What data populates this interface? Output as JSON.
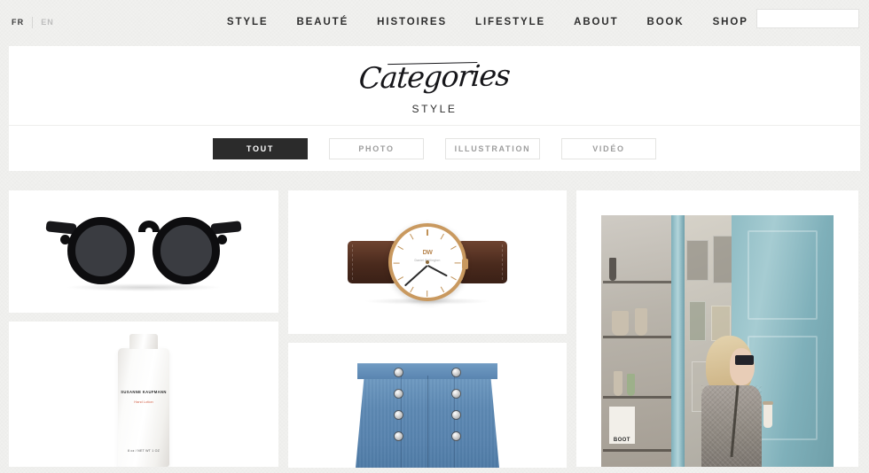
{
  "nav": {
    "languages": [
      {
        "label": "FR",
        "active": true
      },
      {
        "label": "EN",
        "active": false
      }
    ],
    "menu": [
      {
        "label": "STYLE"
      },
      {
        "label": "BEAUTÉ"
      },
      {
        "label": "HISTOIRES"
      },
      {
        "label": "LIFESTYLE"
      },
      {
        "label": "ABOUT"
      },
      {
        "label": "BOOK"
      },
      {
        "label": "SHOP"
      }
    ],
    "search": {
      "value": "",
      "placeholder": "",
      "icon": "search-icon"
    }
  },
  "header": {
    "script_title": "Categories",
    "subtitle": "STYLE"
  },
  "filters": [
    {
      "label": "TOUT",
      "active": true
    },
    {
      "label": "PHOTO",
      "active": false
    },
    {
      "label": "ILLUSTRATION",
      "active": false
    },
    {
      "label": "VIDÉO",
      "active": false
    }
  ],
  "grid": {
    "items": [
      {
        "name": "sunglasses",
        "description": "Black round frame sunglasses"
      },
      {
        "name": "hand-lotion",
        "description": "White cosmetic bottle"
      },
      {
        "name": "watch",
        "description": "Rose gold watch with brown leather strap"
      },
      {
        "name": "denim-skirt",
        "description": "Blue denim button front skirt"
      },
      {
        "name": "street-style",
        "description": "Woman in grey blazer by blue shop door"
      }
    ]
  },
  "product_labels": {
    "bottle_brand": "SUSANNE KAUFMANN",
    "bottle_name": "Hand Lotion",
    "bottle_volume": "8 oz / NET WT 1 OZ",
    "watch_logo": "DW",
    "watch_sub": "Daniel Wellington",
    "shop_sign": "BOOT"
  },
  "colors": {
    "page_background": "#f1f1ef",
    "card_background": "#ffffff",
    "active_filter": "#2b2b2b",
    "nav_text": "#2e2e2e",
    "muted_text": "#9d9d9d",
    "border": "#e4e4e2"
  }
}
